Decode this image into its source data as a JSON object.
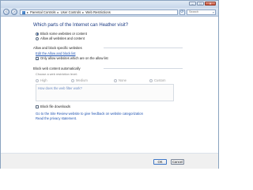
{
  "window": {
    "controls": {
      "minimize": "–",
      "maximize": "□",
      "close": "✕"
    }
  },
  "nav": {
    "back_icon": "arrow-left-icon",
    "forward_icon": "arrow-right-icon",
    "breadcrumbs": [
      "Parental Controls",
      "User Controls",
      "Web Restrictions"
    ],
    "separator": "▸",
    "search_placeholder": "Search"
  },
  "main": {
    "heading": "Which parts of the Internet can Heather visit?",
    "mode_options": [
      {
        "label": "Block some websites or content",
        "selected": true
      },
      {
        "label": "Allow all websites and content",
        "selected": false
      }
    ],
    "allow_block_section": {
      "title": "Allow and block specific websites",
      "edit_link": "Edit the Allow and block list",
      "only_allow_label": "Only allow websites which are on the allow list",
      "only_allow_checked": true
    },
    "block_content_section": {
      "title": "Block web content automatically",
      "hint": "Choose a web restriction level:",
      "levels": [
        "High",
        "Medium",
        "None",
        "Custom"
      ],
      "filter_link": "How does the web filter work?",
      "block_downloads_label": "Block file downloads",
      "block_downloads_checked": false
    },
    "footer_links": {
      "site_review": "Go to the Site Review website to give feedback on website categorization",
      "privacy": "Read the privacy statement."
    }
  },
  "buttons": {
    "ok": "OK",
    "cancel": "Cancel"
  },
  "colors": {
    "heading": "#1c3b83",
    "link": "#1f52b0",
    "titlebar": "#c7d7ea"
  }
}
